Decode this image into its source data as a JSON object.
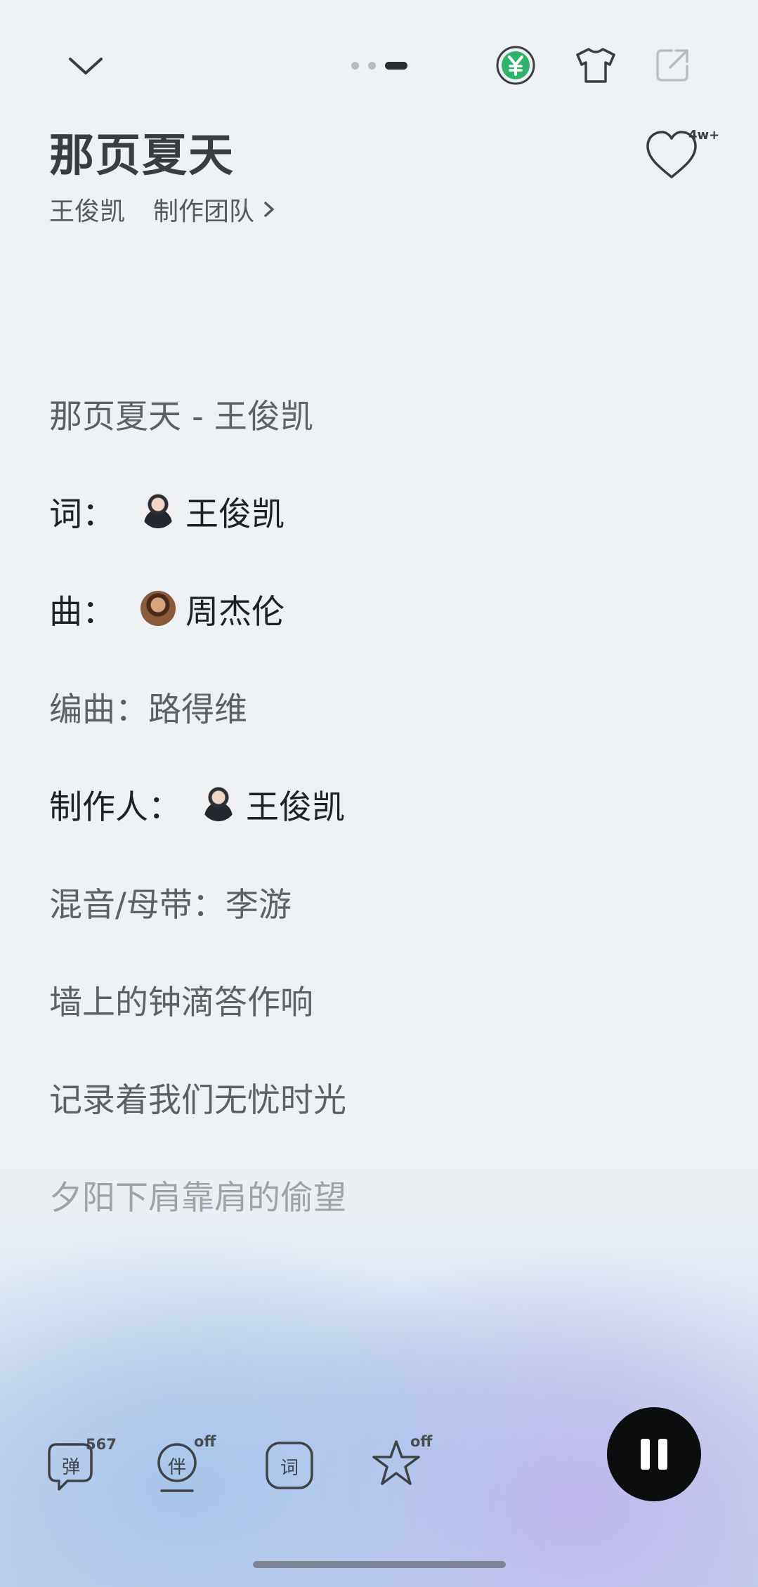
{
  "header": {
    "song_title": "那页夏天",
    "artist": "王俊凯",
    "team_link": "制作团队",
    "like_count": "4w+"
  },
  "icons": {
    "collapse": "chevron-down-icon",
    "vip": "yen-coin-icon",
    "theme": "tshirt-icon",
    "share": "share-icon",
    "like": "heart-icon",
    "pause": "pause-icon"
  },
  "lyrics": {
    "line_title": "那页夏天 - 王俊凯",
    "lyricist_label": "词：",
    "lyricist_name": "王俊凯",
    "composer_label": "曲：",
    "composer_name": "周杰伦",
    "arranger": "编曲：路得维",
    "producer_label": "制作人：",
    "producer_name": "王俊凯",
    "mixing": "混音/母带：李游",
    "line_1": "墙上的钟滴答作响",
    "line_2": "记录着我们无忧时光",
    "line_3": "夕阳下肩靠肩的偷望"
  },
  "toolbar": {
    "danmaku_glyph": "弹",
    "danmaku_count": "567",
    "accompany_glyph": "伴",
    "accompany_state": "off",
    "lyrics_glyph": "词",
    "effect_state": "off"
  },
  "colors": {
    "background": "#eef1f3",
    "vip_green": "#2fb36b",
    "play_button": "#0c0d0f"
  }
}
